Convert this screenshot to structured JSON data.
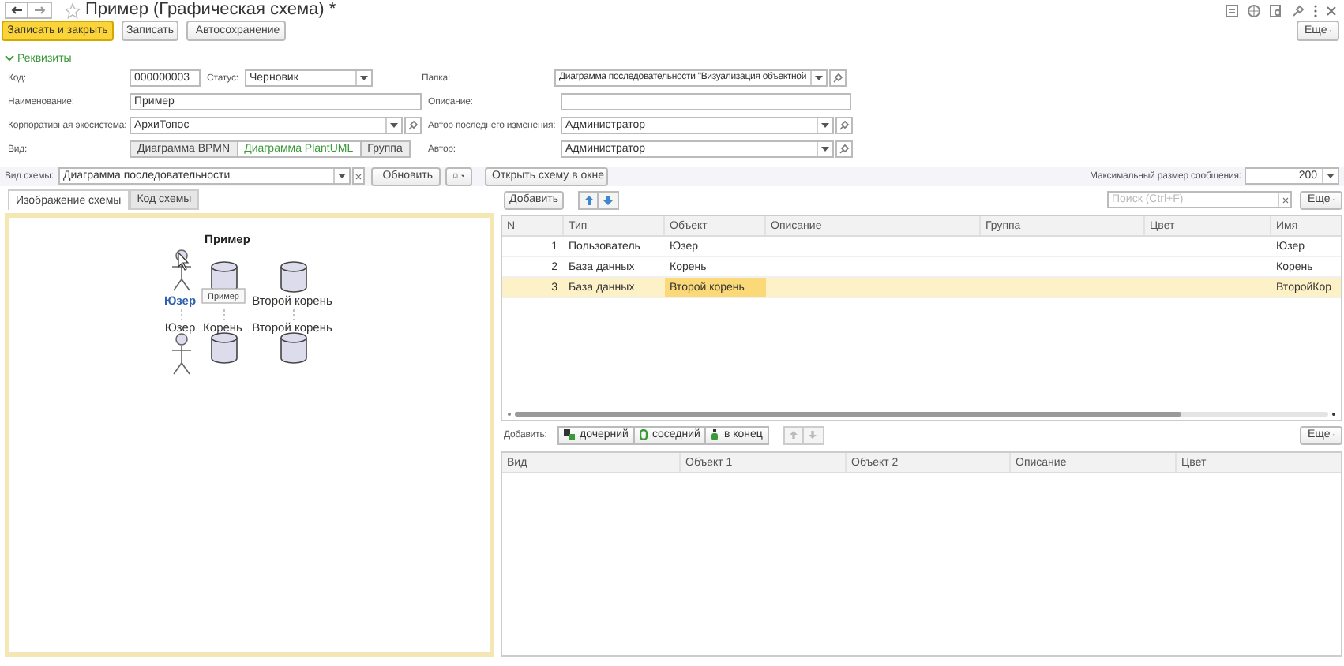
{
  "window": {
    "title": "Пример (Графическая схема) *"
  },
  "toolbar": {
    "buttons": [
      {
        "label": "Записать и закрыть",
        "kind": "primary"
      },
      {
        "label": "Записать",
        "kind": "plain"
      },
      {
        "label": "Автосохранение",
        "kind": "autosave"
      }
    ],
    "more": "Еще"
  },
  "section": {
    "title": "Реквизиты",
    "expanded": true
  },
  "form": {
    "code": {
      "label": "Код:",
      "value": "000000003"
    },
    "status": {
      "label": "Статус:",
      "value": "Черновик"
    },
    "name": {
      "label": "Наименование:",
      "value": "Пример"
    },
    "ecosystem": {
      "label": "Корпоративная экосистема:",
      "value": "АрхиТопос"
    },
    "view": {
      "label": "Вид:",
      "options": [
        {
          "label": "Диаграмма BPMN",
          "selected": false
        },
        {
          "label": "Диаграмма PlantUML",
          "selected": true
        },
        {
          "label": "Группа",
          "selected": false
        }
      ]
    },
    "folder": {
      "label": "Папка:",
      "value": "Диаграмма последовательности \"Визуализация объектной"
    },
    "description": {
      "label": "Описание:"
    },
    "last_author": {
      "label": "Автор последнего изменения:",
      "value": "Администратор"
    },
    "author": {
      "label": "Автор:",
      "value": "Администратор"
    }
  },
  "schema_bar": {
    "label": "Вид схемы:",
    "value": "Диаграмма последовательности",
    "refresh": "Обновить",
    "open": "Открыть схему в окне",
    "max_label": "Максимальный размер сообщения:",
    "max_value": "200"
  },
  "tabs": [
    {
      "label": "Изображение схемы",
      "selected": true
    },
    {
      "label": "Код схемы",
      "selected": false
    }
  ],
  "diagram": {
    "title": "Пример",
    "tooltip": "Пример",
    "participants": [
      {
        "kind": "actor",
        "top_label": "Юзер",
        "bottom_label": "Юзер",
        "highlighted": true
      },
      {
        "kind": "database",
        "bottom_label": "Корень"
      },
      {
        "kind": "database",
        "top_label": "Второй корень",
        "bottom_label": "Второй корень"
      }
    ]
  },
  "objects": {
    "add": "Добавить",
    "search_placeholder": "Поиск (Ctrl+F)",
    "more": "Еще",
    "columns": [
      "N",
      "Тип",
      "Объект",
      "Описание",
      "Группа",
      "Цвет",
      "Имя"
    ],
    "rows": [
      {
        "n": "1",
        "type": "Пользователь",
        "object": "Юзер",
        "name": "Юзер",
        "selected": false
      },
      {
        "n": "2",
        "type": "База данных",
        "object": "Корень",
        "name": "Корень",
        "selected": false
      },
      {
        "n": "3",
        "type": "База данных",
        "object": "Второй корень",
        "name": "ВторойКор",
        "selected": true
      }
    ]
  },
  "links": {
    "add_label": "Добавить:",
    "buttons": [
      {
        "label": "дочерний",
        "kind": "child"
      },
      {
        "label": "соседний",
        "kind": "sibling"
      },
      {
        "label": "в конец",
        "kind": "end"
      }
    ],
    "more": "Еще",
    "columns": [
      "Вид",
      "Объект 1",
      "Объект 2",
      "Описание",
      "Цвет"
    ]
  }
}
